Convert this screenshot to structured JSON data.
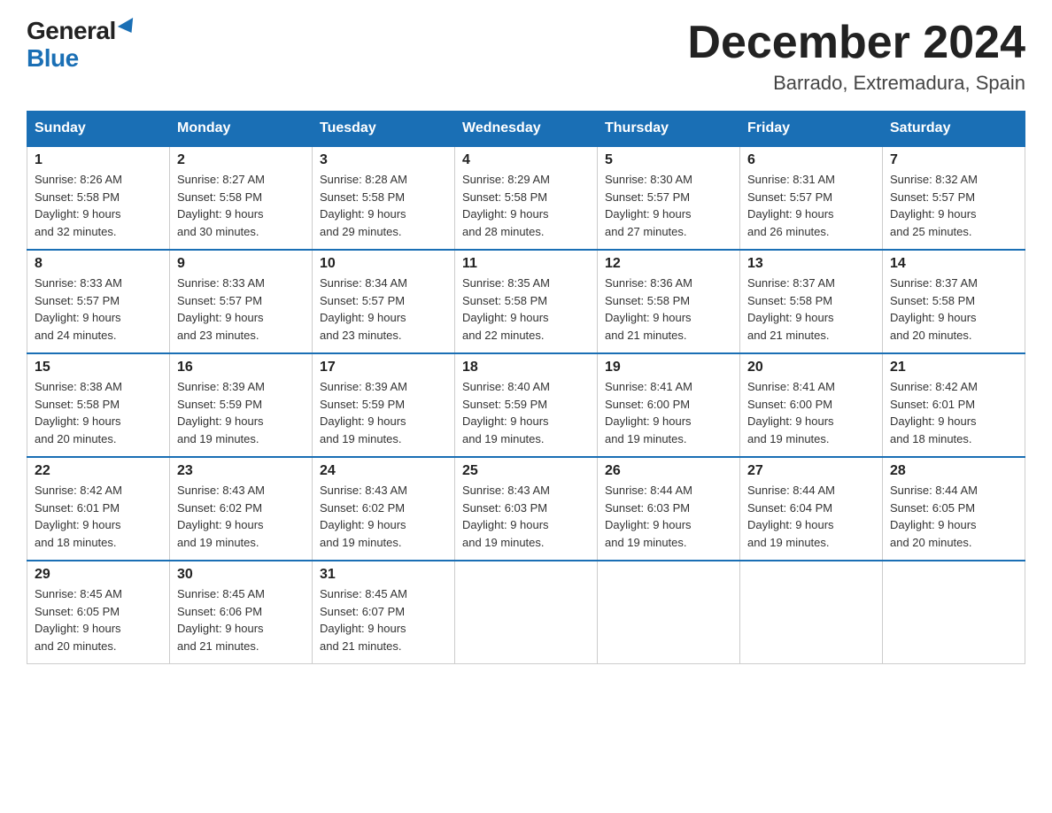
{
  "logo": {
    "general": "General",
    "blue": "Blue",
    "triangle": "▲"
  },
  "title": "December 2024",
  "location": "Barrado, Extremadura, Spain",
  "days_of_week": [
    "Sunday",
    "Monday",
    "Tuesday",
    "Wednesday",
    "Thursday",
    "Friday",
    "Saturday"
  ],
  "weeks": [
    [
      {
        "day": "1",
        "info": "Sunrise: 8:26 AM\nSunset: 5:58 PM\nDaylight: 9 hours\nand 32 minutes."
      },
      {
        "day": "2",
        "info": "Sunrise: 8:27 AM\nSunset: 5:58 PM\nDaylight: 9 hours\nand 30 minutes."
      },
      {
        "day": "3",
        "info": "Sunrise: 8:28 AM\nSunset: 5:58 PM\nDaylight: 9 hours\nand 29 minutes."
      },
      {
        "day": "4",
        "info": "Sunrise: 8:29 AM\nSunset: 5:58 PM\nDaylight: 9 hours\nand 28 minutes."
      },
      {
        "day": "5",
        "info": "Sunrise: 8:30 AM\nSunset: 5:57 PM\nDaylight: 9 hours\nand 27 minutes."
      },
      {
        "day": "6",
        "info": "Sunrise: 8:31 AM\nSunset: 5:57 PM\nDaylight: 9 hours\nand 26 minutes."
      },
      {
        "day": "7",
        "info": "Sunrise: 8:32 AM\nSunset: 5:57 PM\nDaylight: 9 hours\nand 25 minutes."
      }
    ],
    [
      {
        "day": "8",
        "info": "Sunrise: 8:33 AM\nSunset: 5:57 PM\nDaylight: 9 hours\nand 24 minutes."
      },
      {
        "day": "9",
        "info": "Sunrise: 8:33 AM\nSunset: 5:57 PM\nDaylight: 9 hours\nand 23 minutes."
      },
      {
        "day": "10",
        "info": "Sunrise: 8:34 AM\nSunset: 5:57 PM\nDaylight: 9 hours\nand 23 minutes."
      },
      {
        "day": "11",
        "info": "Sunrise: 8:35 AM\nSunset: 5:58 PM\nDaylight: 9 hours\nand 22 minutes."
      },
      {
        "day": "12",
        "info": "Sunrise: 8:36 AM\nSunset: 5:58 PM\nDaylight: 9 hours\nand 21 minutes."
      },
      {
        "day": "13",
        "info": "Sunrise: 8:37 AM\nSunset: 5:58 PM\nDaylight: 9 hours\nand 21 minutes."
      },
      {
        "day": "14",
        "info": "Sunrise: 8:37 AM\nSunset: 5:58 PM\nDaylight: 9 hours\nand 20 minutes."
      }
    ],
    [
      {
        "day": "15",
        "info": "Sunrise: 8:38 AM\nSunset: 5:58 PM\nDaylight: 9 hours\nand 20 minutes."
      },
      {
        "day": "16",
        "info": "Sunrise: 8:39 AM\nSunset: 5:59 PM\nDaylight: 9 hours\nand 19 minutes."
      },
      {
        "day": "17",
        "info": "Sunrise: 8:39 AM\nSunset: 5:59 PM\nDaylight: 9 hours\nand 19 minutes."
      },
      {
        "day": "18",
        "info": "Sunrise: 8:40 AM\nSunset: 5:59 PM\nDaylight: 9 hours\nand 19 minutes."
      },
      {
        "day": "19",
        "info": "Sunrise: 8:41 AM\nSunset: 6:00 PM\nDaylight: 9 hours\nand 19 minutes."
      },
      {
        "day": "20",
        "info": "Sunrise: 8:41 AM\nSunset: 6:00 PM\nDaylight: 9 hours\nand 19 minutes."
      },
      {
        "day": "21",
        "info": "Sunrise: 8:42 AM\nSunset: 6:01 PM\nDaylight: 9 hours\nand 18 minutes."
      }
    ],
    [
      {
        "day": "22",
        "info": "Sunrise: 8:42 AM\nSunset: 6:01 PM\nDaylight: 9 hours\nand 18 minutes."
      },
      {
        "day": "23",
        "info": "Sunrise: 8:43 AM\nSunset: 6:02 PM\nDaylight: 9 hours\nand 19 minutes."
      },
      {
        "day": "24",
        "info": "Sunrise: 8:43 AM\nSunset: 6:02 PM\nDaylight: 9 hours\nand 19 minutes."
      },
      {
        "day": "25",
        "info": "Sunrise: 8:43 AM\nSunset: 6:03 PM\nDaylight: 9 hours\nand 19 minutes."
      },
      {
        "day": "26",
        "info": "Sunrise: 8:44 AM\nSunset: 6:03 PM\nDaylight: 9 hours\nand 19 minutes."
      },
      {
        "day": "27",
        "info": "Sunrise: 8:44 AM\nSunset: 6:04 PM\nDaylight: 9 hours\nand 19 minutes."
      },
      {
        "day": "28",
        "info": "Sunrise: 8:44 AM\nSunset: 6:05 PM\nDaylight: 9 hours\nand 20 minutes."
      }
    ],
    [
      {
        "day": "29",
        "info": "Sunrise: 8:45 AM\nSunset: 6:05 PM\nDaylight: 9 hours\nand 20 minutes."
      },
      {
        "day": "30",
        "info": "Sunrise: 8:45 AM\nSunset: 6:06 PM\nDaylight: 9 hours\nand 21 minutes."
      },
      {
        "day": "31",
        "info": "Sunrise: 8:45 AM\nSunset: 6:07 PM\nDaylight: 9 hours\nand 21 minutes."
      },
      {
        "day": "",
        "info": ""
      },
      {
        "day": "",
        "info": ""
      },
      {
        "day": "",
        "info": ""
      },
      {
        "day": "",
        "info": ""
      }
    ]
  ]
}
